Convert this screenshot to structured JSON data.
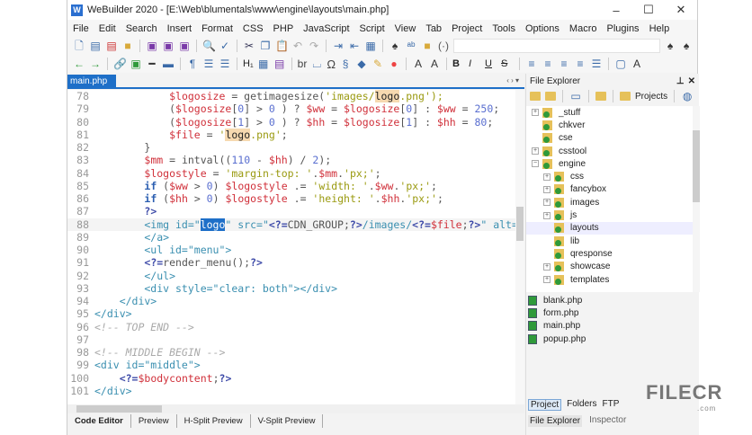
{
  "window": {
    "title": "WeBuilder 2020 - [E:\\Web\\blumentals\\www\\engine\\layouts\\main.php]",
    "minimize": "–",
    "maximize": "☐",
    "close": "✕"
  },
  "menu": [
    "File",
    "Edit",
    "Search",
    "Insert",
    "Format",
    "CSS",
    "PHP",
    "JavaScript",
    "Script",
    "View",
    "Tab",
    "Project",
    "Tools",
    "Options",
    "Macro",
    "Plugins",
    "Help"
  ],
  "toolbar2": {
    "heading": "H₁",
    "br": "br",
    "omega": "Ω",
    "bold": "B",
    "italic": "I",
    "underline": "U",
    "strike": "S"
  },
  "editor_tab": {
    "label": "main.php",
    "close": "✕",
    "nav": "‹ › ▾"
  },
  "code": [
    {
      "n": "78",
      "tokens": [
        [
          "            ",
          "p"
        ],
        [
          "$logosize",
          "v"
        ],
        [
          " = getimagesize(",
          "p"
        ],
        [
          "'images/",
          "s"
        ],
        [
          "logo",
          "hl"
        ],
        [
          ".png');",
          "s"
        ]
      ]
    },
    {
      "n": "79",
      "tokens": [
        [
          "            (",
          "p"
        ],
        [
          "$logosize",
          "v"
        ],
        [
          "[",
          "p"
        ],
        [
          "0",
          "n"
        ],
        [
          "] > ",
          "p"
        ],
        [
          "0",
          "n"
        ],
        [
          " ) ? ",
          "p"
        ],
        [
          "$ww",
          "v"
        ],
        [
          " = ",
          "p"
        ],
        [
          "$logosize",
          "v"
        ],
        [
          "[",
          "p"
        ],
        [
          "0",
          "n"
        ],
        [
          "] : ",
          "p"
        ],
        [
          "$ww",
          "v"
        ],
        [
          " = ",
          "p"
        ],
        [
          "250",
          "n"
        ],
        [
          ";",
          "p"
        ]
      ]
    },
    {
      "n": "80",
      "tokens": [
        [
          "            (",
          "p"
        ],
        [
          "$logosize",
          "v"
        ],
        [
          "[",
          "p"
        ],
        [
          "1",
          "n"
        ],
        [
          "] > ",
          "p"
        ],
        [
          "0",
          "n"
        ],
        [
          " ) ? ",
          "p"
        ],
        [
          "$hh",
          "v"
        ],
        [
          " = ",
          "p"
        ],
        [
          "$logosize",
          "v"
        ],
        [
          "[",
          "p"
        ],
        [
          "1",
          "n"
        ],
        [
          "] : ",
          "p"
        ],
        [
          "$hh",
          "v"
        ],
        [
          " = ",
          "p"
        ],
        [
          "80",
          "n"
        ],
        [
          ";",
          "p"
        ]
      ]
    },
    {
      "n": "81",
      "tokens": [
        [
          "            ",
          "p"
        ],
        [
          "$file",
          "v"
        ],
        [
          " = ",
          "p"
        ],
        [
          "'",
          "s"
        ],
        [
          "logo",
          "hl"
        ],
        [
          ".png'",
          "s"
        ],
        [
          ";",
          "p"
        ]
      ]
    },
    {
      "n": "82",
      "tokens": [
        [
          "        }",
          "p"
        ]
      ]
    },
    {
      "n": "83",
      "tokens": [
        [
          "        ",
          "p"
        ],
        [
          "$mm",
          "v"
        ],
        [
          " = intval((",
          "p"
        ],
        [
          "110",
          "n"
        ],
        [
          " - ",
          "p"
        ],
        [
          "$hh",
          "v"
        ],
        [
          ") / ",
          "p"
        ],
        [
          "2",
          "n"
        ],
        [
          ");",
          "p"
        ]
      ]
    },
    {
      "n": "84",
      "tokens": [
        [
          "        ",
          "p"
        ],
        [
          "$logostyle",
          "v"
        ],
        [
          " = ",
          "p"
        ],
        [
          "'margin-top: '",
          "s"
        ],
        [
          ".",
          "p"
        ],
        [
          "$mm",
          "v"
        ],
        [
          ".",
          "p"
        ],
        [
          "'px;'",
          "s"
        ],
        [
          ";",
          "p"
        ]
      ]
    },
    {
      "n": "85",
      "tokens": [
        [
          "        ",
          "p"
        ],
        [
          "if",
          "k"
        ],
        [
          " (",
          "p"
        ],
        [
          "$ww",
          "v"
        ],
        [
          " > ",
          "p"
        ],
        [
          "0",
          "n"
        ],
        [
          ") ",
          "p"
        ],
        [
          "$logostyle",
          "v"
        ],
        [
          " .= ",
          "p"
        ],
        [
          "'width: '",
          "s"
        ],
        [
          ".",
          "p"
        ],
        [
          "$ww",
          "v"
        ],
        [
          ".",
          "p"
        ],
        [
          "'px;'",
          "s"
        ],
        [
          ";",
          "p"
        ]
      ]
    },
    {
      "n": "86",
      "tokens": [
        [
          "        ",
          "p"
        ],
        [
          "if",
          "k"
        ],
        [
          " (",
          "p"
        ],
        [
          "$hh",
          "v"
        ],
        [
          " > ",
          "p"
        ],
        [
          "0",
          "n"
        ],
        [
          ") ",
          "p"
        ],
        [
          "$logostyle",
          "v"
        ],
        [
          " .= ",
          "p"
        ],
        [
          "'height: '",
          "s"
        ],
        [
          ".",
          "p"
        ],
        [
          "$hh",
          "v"
        ],
        [
          ".",
          "p"
        ],
        [
          "'px;'",
          "s"
        ],
        [
          ";",
          "p"
        ]
      ]
    },
    {
      "n": "87",
      "tokens": [
        [
          "        ",
          "p"
        ],
        [
          "?>",
          "h"
        ]
      ]
    },
    {
      "n": "88",
      "cur": true,
      "tokens": [
        [
          "        <img id=\"",
          "t"
        ],
        [
          "logo",
          "sel"
        ],
        [
          "\" src=\"",
          "t"
        ],
        [
          "<?=",
          "h"
        ],
        [
          "CDN_GROUP;",
          "p"
        ],
        [
          "?>",
          "h"
        ],
        [
          "/images/",
          "t"
        ],
        [
          "<?=",
          "h"
        ],
        [
          "$file",
          "v"
        ],
        [
          ";",
          "p"
        ],
        [
          "?>",
          "h"
        ],
        [
          "\" alt=\"",
          "t"
        ],
        [
          "<?=",
          "h"
        ]
      ]
    },
    {
      "n": "89",
      "tokens": [
        [
          "        </a>",
          "t"
        ]
      ]
    },
    {
      "n": "90",
      "tokens": [
        [
          "        <ul id=\"menu\">",
          "t"
        ]
      ]
    },
    {
      "n": "91",
      "tokens": [
        [
          "        ",
          "p"
        ],
        [
          "<?=",
          "h"
        ],
        [
          "render_menu();",
          "p"
        ],
        [
          "?>",
          "h"
        ]
      ]
    },
    {
      "n": "92",
      "tokens": [
        [
          "        </ul>",
          "t"
        ]
      ]
    },
    {
      "n": "93",
      "tokens": [
        [
          "        <div style=\"clear: both\"></div>",
          "t"
        ]
      ]
    },
    {
      "n": "94",
      "tokens": [
        [
          "    </div>",
          "t"
        ]
      ]
    },
    {
      "n": "95",
      "tokens": [
        [
          "</div>",
          "t"
        ]
      ]
    },
    {
      "n": "96",
      "tokens": [
        [
          "<!-- TOP END -->",
          "c"
        ]
      ]
    },
    {
      "n": "97",
      "tokens": []
    },
    {
      "n": "98",
      "tokens": [
        [
          "<!-- MIDDLE BEGIN -->",
          "c"
        ]
      ]
    },
    {
      "n": "99",
      "tokens": [
        [
          "<div id=\"middle\">",
          "t"
        ]
      ]
    },
    {
      "n": "100",
      "tokens": [
        [
          "    ",
          "p"
        ],
        [
          "<?=",
          "h"
        ],
        [
          "$bodycontent",
          "v"
        ],
        [
          ";",
          "p"
        ],
        [
          "?>",
          "h"
        ]
      ]
    },
    {
      "n": "101",
      "tokens": [
        [
          "</div>",
          "t"
        ]
      ]
    }
  ],
  "bottom_tabs": [
    "Code Editor",
    "Preview",
    "H-Split Preview",
    "V-Split Preview"
  ],
  "panel": {
    "title": "File Explorer",
    "pin": "📌",
    "close": "✕",
    "projects": "Projects",
    "tree": [
      {
        "label": "_stuff",
        "level": 0,
        "exp": "+"
      },
      {
        "label": "chkver",
        "level": 0,
        "exp": ""
      },
      {
        "label": "cse",
        "level": 0,
        "exp": ""
      },
      {
        "label": "csstool",
        "level": 0,
        "exp": "+"
      },
      {
        "label": "engine",
        "level": 0,
        "exp": "−"
      },
      {
        "label": "css",
        "level": 1,
        "exp": "+"
      },
      {
        "label": "fancybox",
        "level": 1,
        "exp": "+"
      },
      {
        "label": "images",
        "level": 1,
        "exp": "+"
      },
      {
        "label": "js",
        "level": 1,
        "exp": "+"
      },
      {
        "label": "layouts",
        "level": 1,
        "exp": "",
        "selected": true
      },
      {
        "label": "lib",
        "level": 1,
        "exp": ""
      },
      {
        "label": "qresponse",
        "level": 1,
        "exp": ""
      },
      {
        "label": "showcase",
        "level": 1,
        "exp": "+"
      },
      {
        "label": "templates",
        "level": 1,
        "exp": "+"
      }
    ],
    "files": [
      "blank.php",
      "form.php",
      "main.php",
      "popup.php"
    ],
    "tabs1": [
      "Project",
      "Folders",
      "FTP"
    ],
    "tabs2": [
      "File Explorer",
      "Inspector"
    ]
  },
  "watermark": {
    "brand": "FILECR",
    "sub": ".com"
  }
}
